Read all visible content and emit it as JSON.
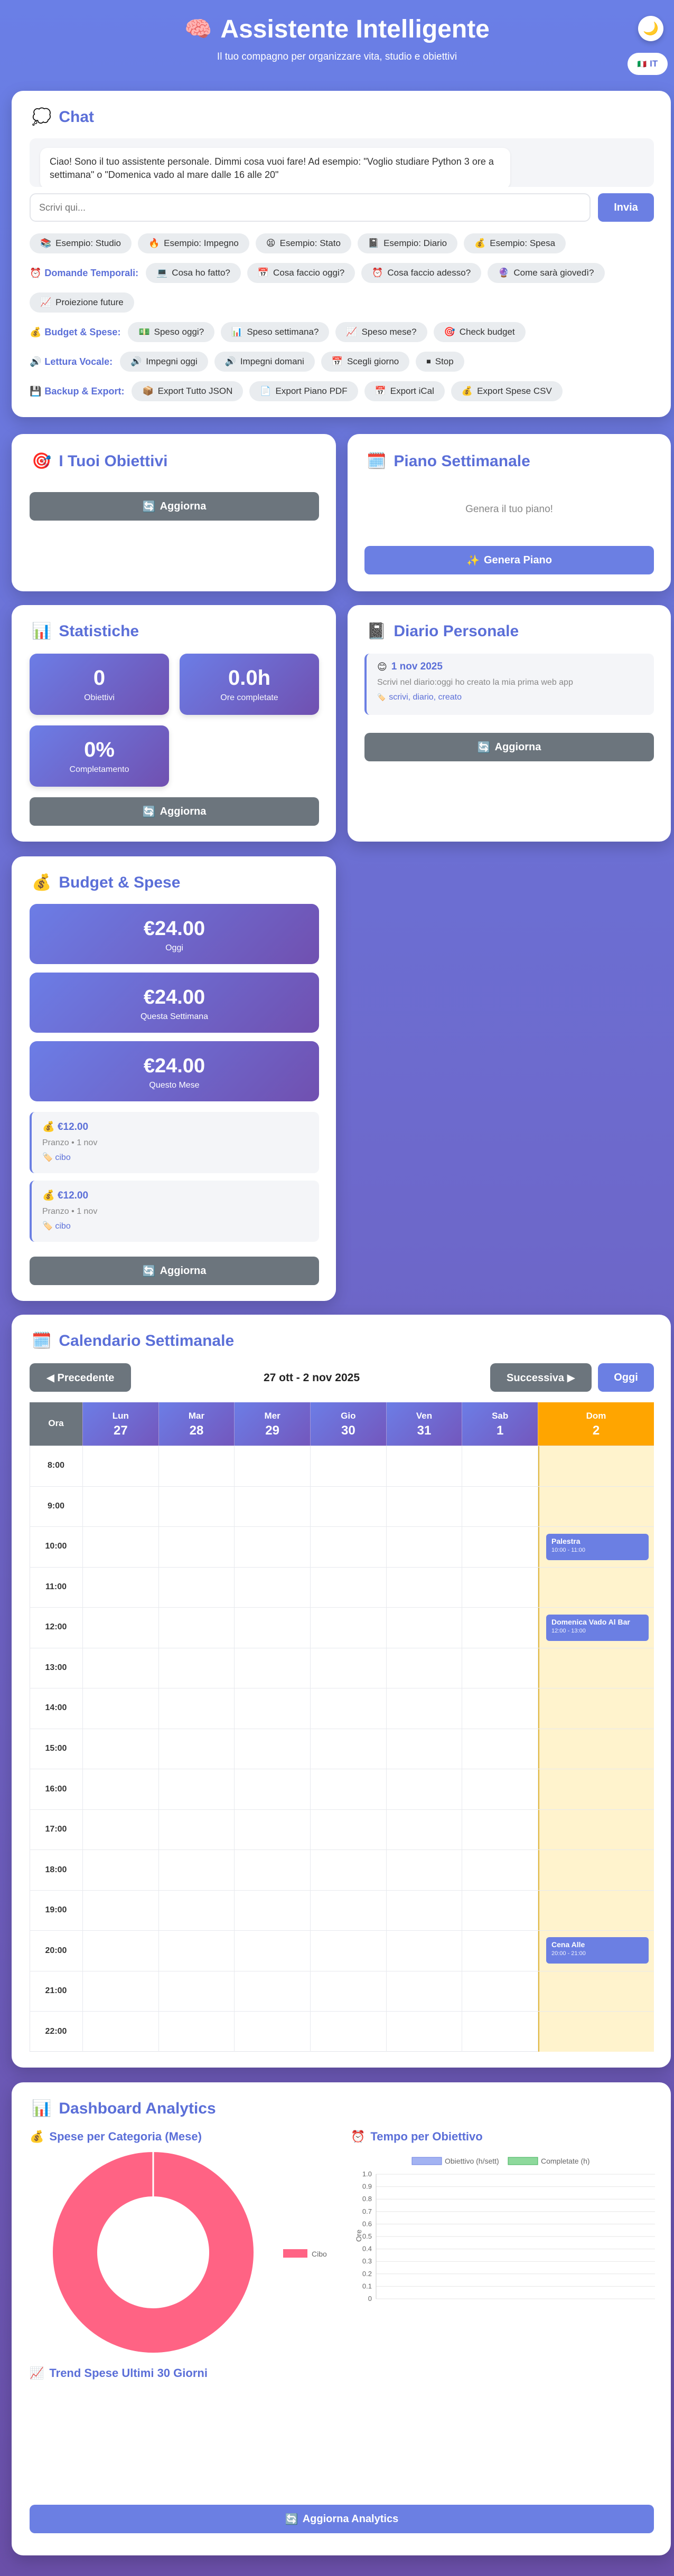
{
  "header": {
    "title": "Assistente Intelligente",
    "subtitle": "Il tuo compagno per organizzare vita, studio e obiettivi",
    "lang": "IT",
    "theme_icon": "moon-icon",
    "brain_icon": "brain-icon"
  },
  "chat": {
    "title": "Chat",
    "message": "Ciao! Sono il tuo assistente personale. Dimmi cosa vuoi fare! Ad esempio: \"Voglio studiare Python 3 ore a settimana\" o \"Domenica vado al mare dalle 16 alle 20\"",
    "placeholder": "Scrivi qui...",
    "send": "Invia",
    "examples": [
      "Esempio: Studio",
      "Esempio: Impegno",
      "Esempio: Stato",
      "Esempio: Diario",
      "Esempio: Spesa"
    ],
    "temporal_label": "Domande Temporali:",
    "temporal": [
      "Cosa ho fatto?",
      "Cosa faccio oggi?",
      "Cosa faccio adesso?",
      "Come sarà giovedì?",
      "Proiezione future"
    ],
    "budget_label": "Budget & Spese:",
    "budget": [
      "Speso oggi?",
      "Speso settimana?",
      "Speso mese?",
      "Check budget"
    ],
    "voice_label": "Lettura Vocale:",
    "voice": [
      "Impegni oggi",
      "Impegni domani",
      "Scegli giorno",
      "Stop"
    ],
    "backup_label": "Backup & Export:",
    "backup": [
      "Export Tutto JSON",
      "Export Piano PDF",
      "Export iCal",
      "Export Spese CSV"
    ]
  },
  "goals": {
    "title": "I Tuoi Obiettivi",
    "refresh": "Aggiorna"
  },
  "plan": {
    "title": "Piano Settimanale",
    "empty": "Genera il tuo piano!",
    "generate": "Genera Piano"
  },
  "stats": {
    "title": "Statistiche",
    "items": [
      {
        "value": "0",
        "label": "Obiettivi"
      },
      {
        "value": "0.0h",
        "label": "Ore completate"
      },
      {
        "value": "0%",
        "label": "Completamento"
      }
    ],
    "refresh": "Aggiorna"
  },
  "diary": {
    "title": "Diario Personale",
    "entry_date": "1 nov 2025",
    "entry_text": "Scrivi nel diario:oggi ho creato la mia prima web app",
    "entry_tags": "scrivi, diario, creato",
    "refresh": "Aggiorna"
  },
  "budget": {
    "title": "Budget & Spese",
    "totals": [
      {
        "value": "€24.00",
        "label": "Oggi"
      },
      {
        "value": "€24.00",
        "label": "Questa Settimana"
      },
      {
        "value": "€24.00",
        "label": "Questo Mese"
      }
    ],
    "expenses": [
      {
        "amount": "€12.00",
        "desc": "Pranzo • 1 nov",
        "cat": "cibo"
      },
      {
        "amount": "€12.00",
        "desc": "Pranzo • 1 nov",
        "cat": "cibo"
      }
    ],
    "refresh": "Aggiorna"
  },
  "calendar": {
    "title": "Calendario Settimanale",
    "prev": "◀ Precedente",
    "range": "27 ott - 2 nov 2025",
    "next": "Successiva ▶",
    "today": "Oggi",
    "hour_header": "Ora",
    "days": [
      {
        "name": "Lun",
        "num": "27"
      },
      {
        "name": "Mar",
        "num": "28"
      },
      {
        "name": "Mer",
        "num": "29"
      },
      {
        "name": "Gio",
        "num": "30"
      },
      {
        "name": "Ven",
        "num": "31"
      },
      {
        "name": "Sab",
        "num": "1"
      },
      {
        "name": "Dom",
        "num": "2"
      }
    ],
    "hours": [
      "8:00",
      "9:00",
      "10:00",
      "11:00",
      "12:00",
      "13:00",
      "14:00",
      "15:00",
      "16:00",
      "17:00",
      "18:00",
      "19:00",
      "20:00",
      "21:00",
      "22:00"
    ],
    "events": [
      {
        "title": "Palestra",
        "time": "10:00 - 11:00"
      },
      {
        "title": "Domenica Vado Al Bar",
        "time": "12:00 - 13:00"
      },
      {
        "title": "Cena Alle",
        "time": "20:00 - 21:00"
      }
    ]
  },
  "analytics": {
    "title": "Dashboard Analytics",
    "spend_cat": "Spese per Categoria (Mese)",
    "pie_legend": "Cibo",
    "time_goal": "Tempo per Obiettivo",
    "legend_target": "Obiettivo (h/sett)",
    "legend_done": "Completate (h)",
    "y_axis": "Ore",
    "y_ticks": [
      "1.0",
      "0.9",
      "0.8",
      "0.7",
      "0.6",
      "0.5",
      "0.4",
      "0.3",
      "0.2",
      "0.1",
      "0"
    ],
    "trend": "Trend Spese Ultimi 30 Giorni",
    "refresh": "Aggiorna Analytics"
  },
  "chart_data": [
    {
      "type": "pie",
      "categories": [
        "Cibo"
      ],
      "values": [
        24
      ],
      "legend": "right",
      "colors": [
        "#ff6384"
      ]
    },
    {
      "type": "bar",
      "categories": [],
      "series": [
        {
          "name": "Obiettivo (h/sett)",
          "values": []
        },
        {
          "name": "Completate (h)",
          "values": []
        }
      ],
      "ylabel": "Ore",
      "ylim": [
        0,
        1
      ],
      "legend": "top"
    }
  ],
  "colors": {
    "accent": "#6b7fe3",
    "today": "#ffa500",
    "gray": "#6c757d"
  }
}
